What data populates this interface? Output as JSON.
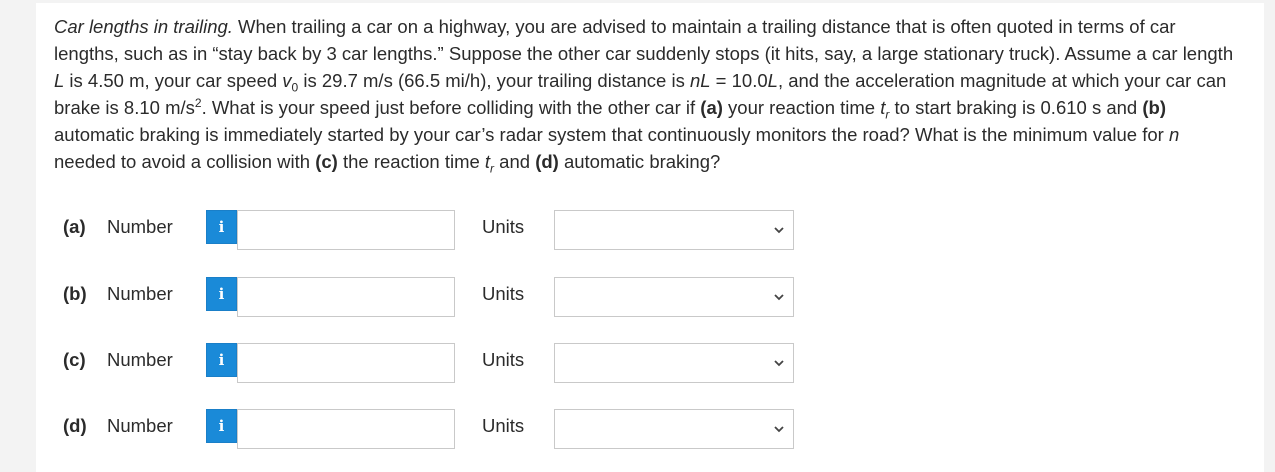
{
  "problem": {
    "title": "Car lengths in trailing.",
    "t1": " When trailing a car on a highway, you are advised to maintain a trailing distance that is often quoted in terms of car lengths, such as in “stay back by 3 car lengths.” Suppose the other car suddenly stops (it hits, say, a large stationary truck). Assume a car length ",
    "L": "L",
    "t2": " is 4.50 m, your car speed ",
    "v": "v",
    "v_sub": "0",
    "t3": " is 29.7 m/s (66.5 mi/h), your trailing distance is ",
    "nL": "nL",
    "t4": " = 10.0",
    "L2": "L",
    "t5": ", and the acceleration magnitude at which your car can brake is 8.10 m/s",
    "sq": "2",
    "t6": ". What is your speed just before colliding with the other car if ",
    "pa": "(a)",
    "t7": " your reaction time ",
    "tr1": "t",
    "tr1_sub": "r",
    "t8": " to start braking is 0.610 s and ",
    "pb": "(b)",
    "t9": " automatic braking is immediately started by your car’s radar system that continuously monitors the road? What is the minimum value for ",
    "n": "n",
    "t10": " needed to avoid a collision with ",
    "pc": "(c)",
    "t11": " the reaction time ",
    "tr2": "t",
    "tr2_sub": "r",
    "t12": " and ",
    "pd": "(d)",
    "t13": " automatic braking?"
  },
  "rows": [
    {
      "part": "(a)",
      "number_label": "Number",
      "info": "i",
      "value": "",
      "units_label": "Units",
      "unit_selected": ""
    },
    {
      "part": "(b)",
      "number_label": "Number",
      "info": "i",
      "value": "",
      "units_label": "Units",
      "unit_selected": ""
    },
    {
      "part": "(c)",
      "number_label": "Number",
      "info": "i",
      "value": "",
      "units_label": "Units",
      "unit_selected": ""
    },
    {
      "part": "(d)",
      "number_label": "Number",
      "info": "i",
      "value": "",
      "units_label": "Units",
      "unit_selected": ""
    }
  ],
  "icons": {
    "info": "info-icon",
    "dropdown": "chevron-down-icon"
  },
  "colors": {
    "info_button": "#1a8ad8",
    "background": "#f3f3f3",
    "card": "#ffffff"
  }
}
